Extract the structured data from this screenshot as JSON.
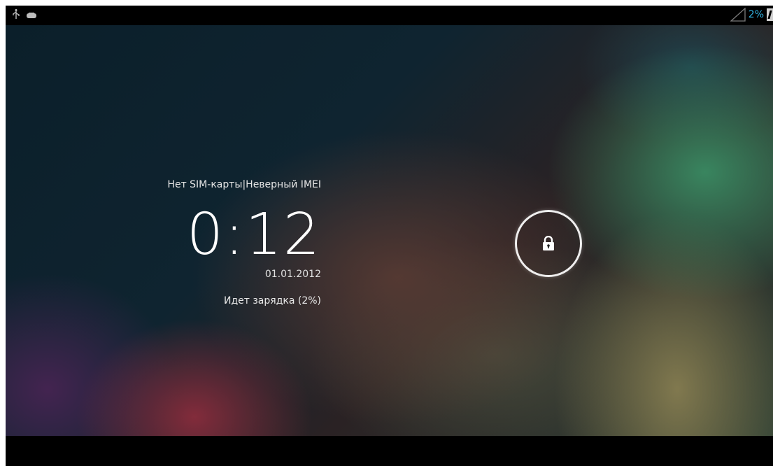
{
  "status_bar": {
    "left_icons": [
      "usb-icon",
      "gamepad-icon"
    ],
    "battery_percent_text": "2%",
    "signal_icon": "signal-icon",
    "battery_icon": "battery-charging-icon",
    "accent_color": "#33b5e5"
  },
  "lockscreen": {
    "carrier_text": "Нет SIM-карты|Неверный IMEI",
    "time": "0:12",
    "date": "01.01.2012",
    "charging_text": "Идет зарядка (2%)",
    "unlock_icon": "lock-icon"
  }
}
